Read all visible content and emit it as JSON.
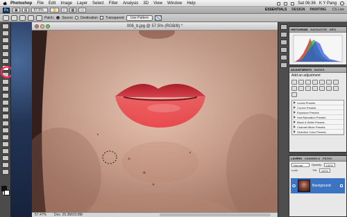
{
  "menubar": {
    "app_name": "Photoshop",
    "items": [
      "File",
      "Edit",
      "Image",
      "Layer",
      "Select",
      "Filter",
      "Analysis",
      "3D",
      "View",
      "Window",
      "Help"
    ],
    "clock": "Sat 06:36",
    "user": "K Y Pang"
  },
  "appbar": {
    "logo": "Ps",
    "zoom_value": "57.5%",
    "workspaces": [
      "ESSENTIALS",
      "DESIGN",
      "PAINTING"
    ],
    "cs_live": "CS Live"
  },
  "options": {
    "patch_label": "Patch:",
    "source_label": "Source",
    "destination_label": "Destination",
    "transparent_label": "Transparent",
    "use_pattern_label": "Use Pattern"
  },
  "document": {
    "filename": "006_b.jpg @ 57.5% (RGB/8) *",
    "zoom": "57.47%",
    "status": "Doc: 25.3M/23.8M"
  },
  "panels": {
    "histogram_tabs": [
      "HISTOGRAM",
      "NAVIGATOR",
      "INFO"
    ],
    "adjust_tabs": [
      "ADJUSTMENTS",
      "MASKS"
    ],
    "add_adjustment": "Add an adjustment",
    "presets": [
      "Levels Presets",
      "Curves Presets",
      "Exposure Presets",
      "Hue/Saturation Presets",
      "Black & White Presets",
      "Channel Mixer Presets",
      "Selective Color Presets"
    ],
    "layers_tabs": [
      "LAYERS",
      "CHANNELS",
      "PATHS"
    ],
    "blend_mode": "Normal",
    "opacity_label": "Opacity:",
    "opacity": "100%",
    "lock_label": "Lock:",
    "fill_label": "Fill:",
    "fill": "100%",
    "layer_name": "Background"
  },
  "colors": {
    "highlight_circle": "#ff2a55",
    "lips": "#e5444f",
    "layer_selected": "#3d73c3"
  },
  "icons": {
    "apple": "apple-icon",
    "selected_tool": "healing-brush-icon"
  }
}
